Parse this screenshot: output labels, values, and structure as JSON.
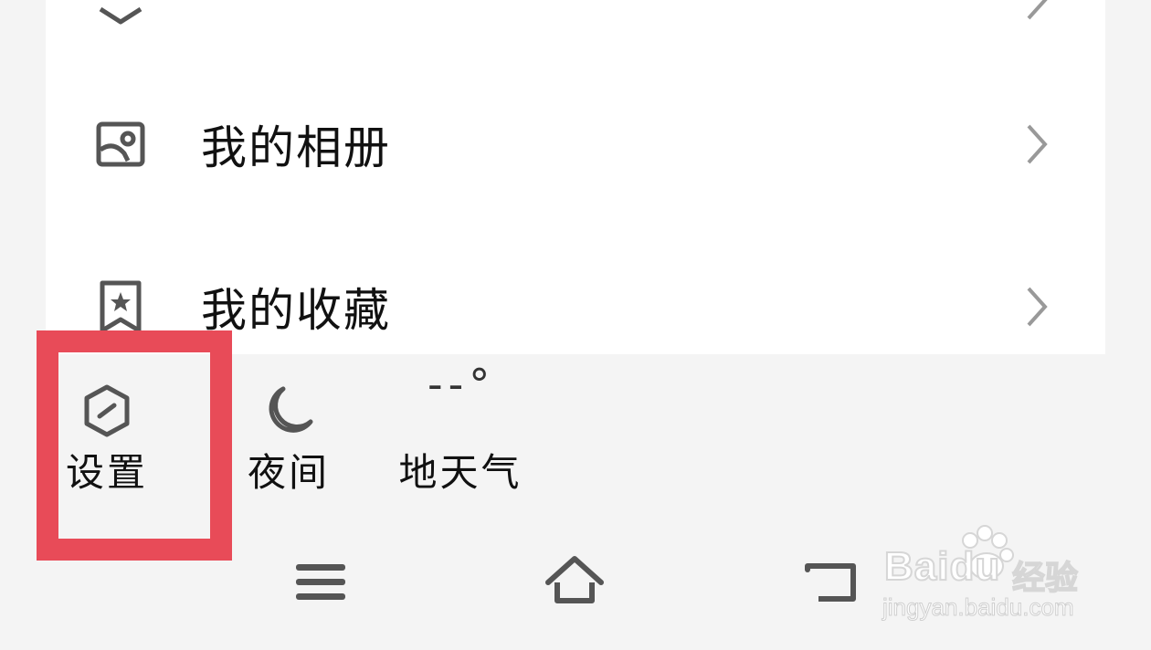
{
  "menu": {
    "partial_item": {
      "label": "",
      "icon": "cube-icon"
    },
    "items": [
      {
        "label": "我的相册",
        "icon": "photo-album-icon"
      },
      {
        "label": "我的收藏",
        "icon": "bookmark-star-icon"
      }
    ]
  },
  "quick_actions": {
    "settings": {
      "label": "设置",
      "icon": "settings-hexagon-icon"
    },
    "night": {
      "label": "夜间",
      "icon": "moon-icon"
    },
    "weather": {
      "label": "地天气",
      "temperature": "--°",
      "icon": "weather-icon"
    }
  },
  "highlight": {
    "color": "#e84b58",
    "target": "settings"
  },
  "navbar": {
    "menu_icon": "hamburger-menu-icon",
    "home_icon": "home-icon",
    "back_icon": "back-icon"
  },
  "watermark": {
    "brand": "Baidu",
    "brand_cn": "经验",
    "url": "jingyan.baidu.com"
  },
  "colors": {
    "background": "#f4f4f4",
    "card": "#ffffff",
    "icon_gray": "#555555",
    "chevron_gray": "#999999",
    "highlight_red": "#e84b58"
  }
}
